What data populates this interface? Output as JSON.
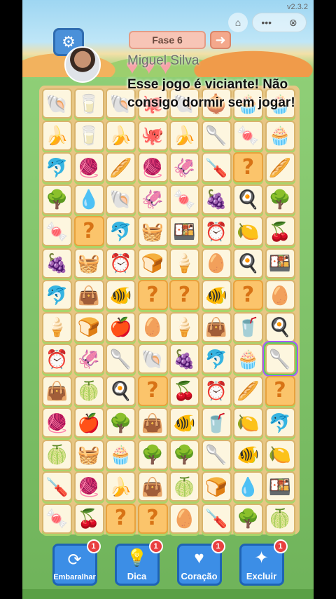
{
  "app": {
    "version": "v2.3.2"
  },
  "header": {
    "level_label": "Fase 6",
    "next_icon": "arrow-right-icon",
    "settings_icon": "gear-icon",
    "home_icon": "home-icon",
    "menu_icon": "more-dots-icon",
    "close_icon": "close-icon"
  },
  "hearts": {
    "count": 3,
    "icon": "heart-icon"
  },
  "overlay": {
    "username": "Miguel Silva",
    "comment": "Esse jogo é viciante! Não consigo dormir sem jogar!"
  },
  "board": {
    "columns": 8,
    "rows": [
      [
        "shell",
        "milk-glass",
        "shell-purple",
        "octopus",
        "shell",
        "onion",
        "cupcake",
        "cupcake"
      ],
      [
        "banana",
        "milk-glass",
        "banana",
        "octopus",
        "banana",
        "spoon",
        "candy",
        "cupcake"
      ],
      [
        "dolphin",
        "yarn",
        "bread",
        "yarn",
        "squid",
        "screwdriver",
        "mystery",
        "bread"
      ],
      [
        "tree",
        "water-drop",
        "shell",
        "squid",
        "candy",
        "grapes",
        "pan",
        "tree"
      ],
      [
        "candy",
        "mystery",
        "dolphin",
        "basket",
        "lunchbox",
        "clock",
        "lemon",
        "cherry"
      ],
      [
        "grapes",
        "basket",
        "clock",
        "toast",
        "popsicle",
        "egg",
        "pan",
        "lunchbox"
      ],
      [
        "dolphin",
        "bag",
        "fish",
        "mystery",
        "mystery",
        "fish",
        "mystery",
        "egg"
      ],
      [
        "popsicle",
        "toast",
        "apple",
        "egg",
        "popsicle",
        "bag",
        "glass",
        "pan"
      ],
      [
        "clock",
        "squid",
        "spoon",
        "shell",
        "grapes",
        "dolphin",
        "cupcake",
        "spoon"
      ],
      [
        "bag",
        "melon",
        "pan",
        "mystery",
        "cherry",
        "clock",
        "bread",
        "mystery"
      ],
      [
        "yarn",
        "apple",
        "tree",
        "bag",
        "fish",
        "glass",
        "lemon",
        "dolphin"
      ],
      [
        "melon",
        "basket",
        "cupcake",
        "tree",
        "tree",
        "spoon",
        "fish",
        "lemon"
      ],
      [
        "screwdriver",
        "yarn",
        "banana",
        "bag",
        "melon",
        "toast",
        "water-drop",
        "lunchbox"
      ],
      [
        "candy",
        "cherry",
        "mystery",
        "mystery",
        "egg",
        "screwdriver",
        "tree",
        "melon"
      ]
    ],
    "selected_tile": {
      "row": 8,
      "col": 7
    }
  },
  "tile_glyphs": {
    "shell": "🐚",
    "shell-purple": "🐚",
    "milk-glass": "🥛",
    "glass": "🥤",
    "octopus": "🐙",
    "onion": "🧅",
    "cupcake": "🧁",
    "banana": "🍌",
    "spoon": "🥄",
    "candy": "🍬",
    "dolphin": "🐬",
    "yarn": "🧶",
    "bread": "🥖",
    "squid": "🦑",
    "screwdriver": "🪛",
    "mystery": "?",
    "tree": "🌳",
    "water-drop": "💧",
    "grapes": "🍇",
    "pan": "🍳",
    "basket": "🧺",
    "lunchbox": "🍱",
    "clock": "⏰",
    "lemon": "🍋",
    "cherry": "🍒",
    "toast": "🍞",
    "popsicle": "🍦",
    "egg": "🥚",
    "bag": "👜",
    "fish": "🐠",
    "apple": "🍎",
    "melon": "🍈"
  },
  "powerups": [
    {
      "label": "Embaralhar",
      "icon": "shuffle-icon",
      "glyph": "⟳",
      "badge": "1"
    },
    {
      "label": "Dica",
      "icon": "lightbulb-icon",
      "glyph": "💡",
      "badge": "1"
    },
    {
      "label": "Coração",
      "icon": "heart-plus-icon",
      "glyph": "♥",
      "badge": "1"
    },
    {
      "label": "Excluir",
      "icon": "magic-wand-icon",
      "glyph": "✦",
      "badge": "1"
    }
  ],
  "colors": {
    "tile_bg": "#fdf6df",
    "mystery_bg": "#fbc46b",
    "board_bg": "#e7c684",
    "button_blue": "#3c8ee6",
    "badge_red": "#e94040"
  }
}
